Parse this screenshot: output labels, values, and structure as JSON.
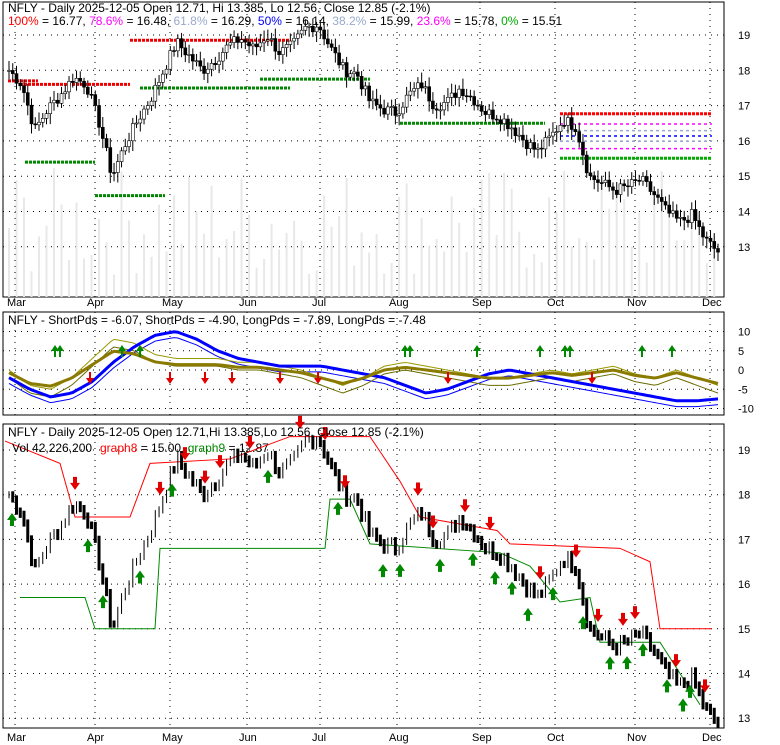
{
  "chart_data": [
    {
      "type": "line",
      "title": "NFLY - Daily 2025-12-05 Open 12.71, Hi 13.385, Lo 12.56, Close 12.85 (-2.1%)",
      "fib": [
        {
          "label": "100%",
          "value": 16.77,
          "color": "#ff0000"
        },
        {
          "label": "78.6%",
          "value": 16.48,
          "color": "#ff00ff"
        },
        {
          "label": "61.8%",
          "value": 16.29,
          "color": "#99aacc"
        },
        {
          "label": "50%",
          "value": 16.14,
          "color": "#0000ff"
        },
        {
          "label": "38.2%",
          "value": 15.99,
          "color": "#99aacc"
        },
        {
          "label": "23.6%",
          "value": 15.78,
          "color": "#ff00ff"
        },
        {
          "label": "0%",
          "value": 15.51,
          "color": "#00aa00"
        }
      ],
      "x_ticks": [
        "Mar",
        "Apr",
        "May",
        "Jun",
        "Jul",
        "Aug",
        "Sep",
        "Oct",
        "Nov",
        "Dec"
      ],
      "y_ticks": [
        13,
        14,
        15,
        16,
        17,
        18,
        19
      ],
      "ylim": [
        12.4,
        19.9
      ],
      "closes": [
        18.0,
        17.6,
        16.3,
        16.9,
        17.3,
        17.8,
        17.6,
        16.5,
        15.0,
        15.9,
        16.6,
        17.2,
        18.0,
        18.8,
        18.4,
        18.0,
        18.3,
        18.7,
        18.9,
        18.6,
        19.0,
        18.5,
        18.7,
        19.2,
        19.3,
        18.6,
        18.0,
        17.9,
        17.1,
        16.9,
        16.8,
        17.3,
        17.6,
        17.0,
        17.1,
        17.5,
        17.2,
        16.8,
        16.7,
        16.4,
        16.0,
        15.7,
        16.1,
        16.6,
        16.4,
        15.0,
        14.8,
        14.6,
        14.7,
        14.9,
        14.5,
        14.0,
        13.7,
        13.9,
        13.2,
        12.85
      ]
    },
    {
      "type": "line",
      "title": "NFLY - ShortPds = -6.07, ShortPds = -4.90, LongPds = -7.89, LongPds = -7.48",
      "legend": [
        {
          "label": "ShortPds",
          "value": "-6.07",
          "color": "#999900"
        },
        {
          "label": "ShortPds",
          "value": "-4.90",
          "color": "#999900"
        },
        {
          "label": "LongPds",
          "value": "-7.89",
          "color": "#0000ff"
        },
        {
          "label": "LongPds",
          "value": "-7.48",
          "color": "#0000ff"
        }
      ],
      "y_ticks": [
        10,
        5,
        0,
        -5,
        -10
      ],
      "ylim": [
        -12,
        12
      ],
      "long": [
        -2,
        -5,
        -7,
        -6,
        -3,
        2,
        6,
        9,
        10,
        8,
        5,
        3,
        2,
        1,
        1,
        1,
        0,
        -1,
        -2,
        -4,
        -6,
        -5,
        -3,
        -1,
        0,
        -1,
        -2,
        -3,
        -4,
        -5,
        -6,
        -7,
        -8,
        -8,
        -7.5
      ],
      "short": [
        -1,
        -5,
        -6,
        -3,
        2,
        7,
        6,
        3,
        2,
        2,
        2,
        1,
        1,
        0,
        -1,
        -3,
        -5,
        -3,
        0,
        1,
        0,
        -1,
        -2,
        -3,
        -3,
        -2,
        -1,
        -2,
        -1,
        0,
        -2,
        -3,
        -1,
        -3,
        -5
      ]
    },
    {
      "type": "line",
      "title": "NFLY - Daily 2025-12-05 Open 12.71,Hi 13.385,Lo 12.56, Close 12.85 (-2.1%)",
      "vol_label": "Vol 42,226,200",
      "graph8": {
        "label": "graph8",
        "value": "15.00",
        "color": "#ff0000"
      },
      "graph9": {
        "label": "graph9",
        "value": "12.87",
        "color": "#008800"
      },
      "y_ticks": [
        13,
        14,
        15,
        16,
        17,
        18,
        19
      ],
      "ylim": [
        12.6,
        19.6
      ]
    }
  ]
}
